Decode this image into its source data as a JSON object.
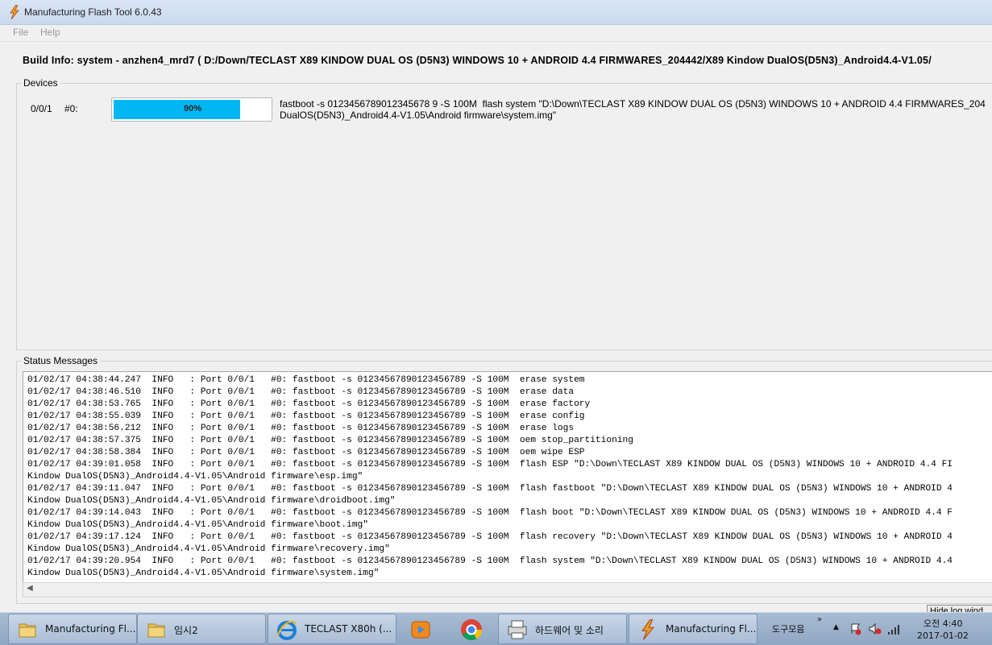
{
  "window": {
    "title": "Manufacturing Flash Tool 6.0.43"
  },
  "menu": {
    "file": "File",
    "help": "Help"
  },
  "build_info": "Build Info: system - anzhen4_mrd7 ( D:/Down/TECLAST X89 KINDOW DUAL OS (D5N3) WINDOWS 10 + ANDROID 4.4 FIRMWARES_204442/X89 Kindow DualOS(D5N3)_Android4.4-V1.05/",
  "devices": {
    "label": "Devices",
    "rows": [
      {
        "port": "0/0/1",
        "id": "#0:",
        "progress_text": "90%",
        "progress": 0.9,
        "command": "fastboot -s 0123456789012345678 9 -S 100M  flash system \"D:\\Down\\TECLAST X89 KINDOW DUAL OS (D5N3) WINDOWS 10 + ANDROID 4.4 FIRMWARES_204\nDualOS(D5N3)_Android4.4-V1.05\\Android firmware\\system.img\""
      }
    ]
  },
  "status": {
    "label": "Status Messages",
    "lines": [
      "01/02/17 04:38:44.247  INFO   : Port 0/0/1   #0: fastboot -s 01234567890123456789 -S 100M  erase system",
      "01/02/17 04:38:46.510  INFO   : Port 0/0/1   #0: fastboot -s 01234567890123456789 -S 100M  erase data",
      "01/02/17 04:38:53.765  INFO   : Port 0/0/1   #0: fastboot -s 01234567890123456789 -S 100M  erase factory",
      "01/02/17 04:38:55.039  INFO   : Port 0/0/1   #0: fastboot -s 01234567890123456789 -S 100M  erase config",
      "01/02/17 04:38:56.212  INFO   : Port 0/0/1   #0: fastboot -s 01234567890123456789 -S 100M  erase logs",
      "01/02/17 04:38:57.375  INFO   : Port 0/0/1   #0: fastboot -s 01234567890123456789 -S 100M  oem stop_partitioning",
      "01/02/17 04:38:58.384  INFO   : Port 0/0/1   #0: fastboot -s 01234567890123456789 -S 100M  oem wipe ESP",
      "01/02/17 04:39:01.058  INFO   : Port 0/0/1   #0: fastboot -s 01234567890123456789 -S 100M  flash ESP \"D:\\Down\\TECLAST X89 KINDOW DUAL OS (D5N3) WINDOWS 10 + ANDROID 4.4 FI",
      "Kindow DualOS(D5N3)_Android4.4-V1.05\\Android firmware\\esp.img\"",
      "01/02/17 04:39:11.047  INFO   : Port 0/0/1   #0: fastboot -s 01234567890123456789 -S 100M  flash fastboot \"D:\\Down\\TECLAST X89 KINDOW DUAL OS (D5N3) WINDOWS 10 + ANDROID 4",
      "Kindow DualOS(D5N3)_Android4.4-V1.05\\Android firmware\\droidboot.img\"",
      "01/02/17 04:39:14.043  INFO   : Port 0/0/1   #0: fastboot -s 01234567890123456789 -S 100M  flash boot \"D:\\Down\\TECLAST X89 KINDOW DUAL OS (D5N3) WINDOWS 10 + ANDROID 4.4 F",
      "Kindow DualOS(D5N3)_Android4.4-V1.05\\Android firmware\\boot.img\"",
      "01/02/17 04:39:17.124  INFO   : Port 0/0/1   #0: fastboot -s 01234567890123456789 -S 100M  flash recovery \"D:\\Down\\TECLAST X89 KINDOW DUAL OS (D5N3) WINDOWS 10 + ANDROID 4",
      "Kindow DualOS(D5N3)_Android4.4-V1.05\\Android firmware\\recovery.img\"",
      "01/02/17 04:39:20.954  INFO   : Port 0/0/1   #0: fastboot -s 01234567890123456789 -S 100M  flash system \"D:\\Down\\TECLAST X89 KINDOW DUAL OS (D5N3) WINDOWS 10 + ANDROID 4.4",
      "Kindow DualOS(D5N3)_Android4.4-V1.05\\Android firmware\\system.img\""
    ]
  },
  "hide_log_button": "Hide log wind",
  "taskbar": {
    "buttons": [
      {
        "label": "Manufacturing Fl...",
        "icon": "folder-icon"
      },
      {
        "label": "임시2",
        "icon": "folder-icon"
      },
      {
        "label": "TECLAST X80h (...",
        "icon": "ie-icon"
      },
      {
        "label": "",
        "icon": "media-player-icon"
      },
      {
        "label": "",
        "icon": "chrome-icon"
      },
      {
        "label": "하드웨어 및 소리",
        "icon": "printer-icon"
      },
      {
        "label": "Manufacturing Fl...",
        "icon": "flash-tool-icon"
      }
    ],
    "toolbar_label": "도구모음",
    "clock_time": "오전 4:40",
    "clock_date": "2017-01-02"
  },
  "colors": {
    "progress_fill": "#00b7f3",
    "taskbar": "#9fb3cd"
  }
}
